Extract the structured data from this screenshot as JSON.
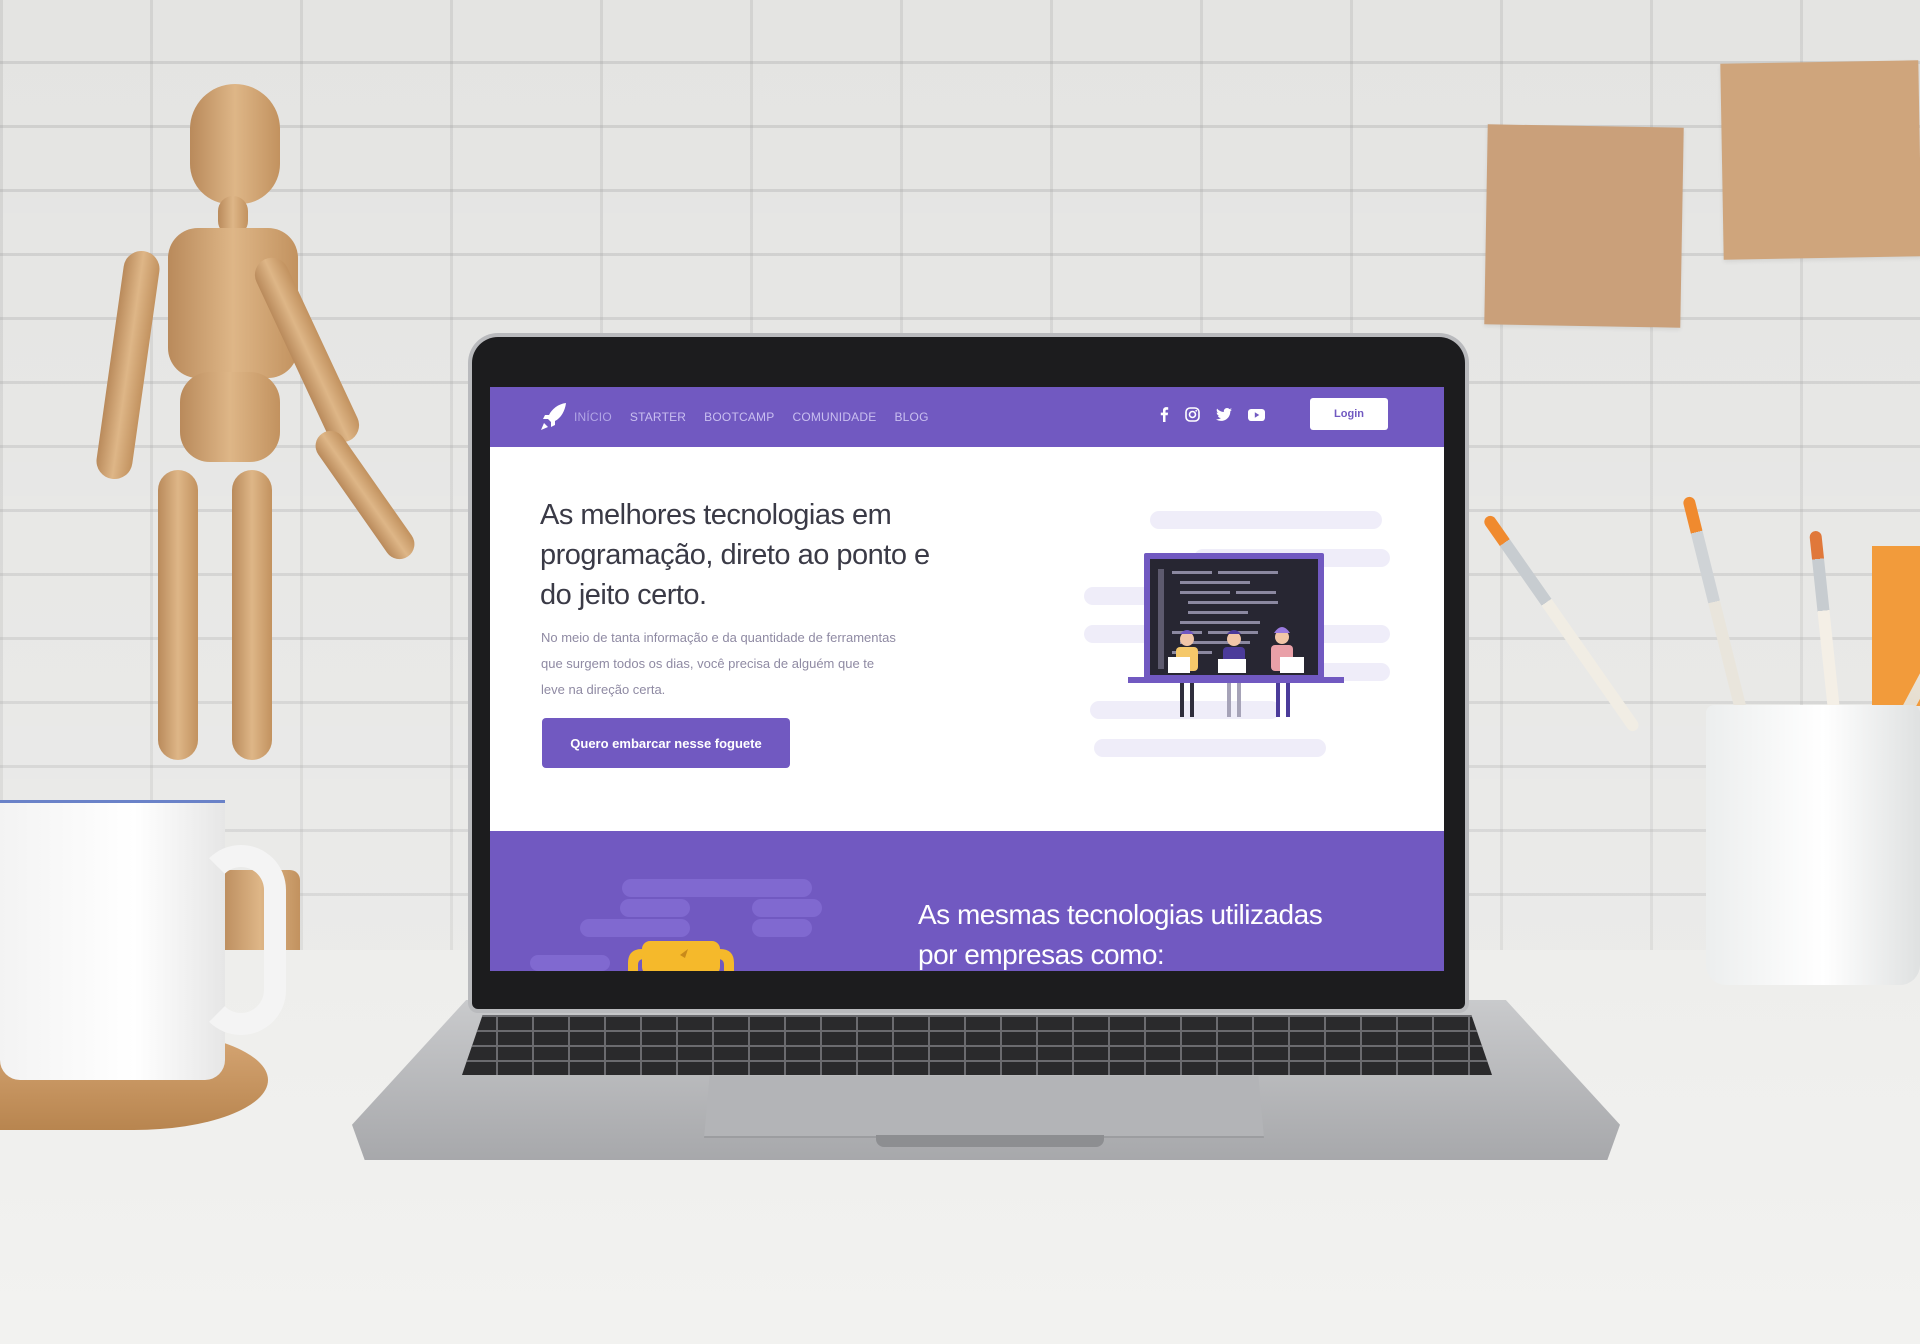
{
  "nav": {
    "links": [
      "INÍCIO",
      "STARTER",
      "BOOTCAMP",
      "COMUNIDADE",
      "BLOG"
    ],
    "social_icons": [
      "facebook-icon",
      "instagram-icon",
      "twitter-icon",
      "youtube-icon"
    ],
    "login_label": "Login"
  },
  "hero": {
    "title": "As melhores tecnologias em programação, direto ao ponto e do jeito certo.",
    "text": "No meio de tanta informação e da quantidade de ferramentas que surgem todos os dias, você precisa de alguém que te leve na direção certa.",
    "cta_label": "Quero embarcar nesse foguete"
  },
  "companies": {
    "title": "As mesmas tecnologias utilizadas por empresas como:"
  },
  "colors": {
    "brand": "#7159c1",
    "nav_text": "#c9bff0",
    "title_text": "#3a3a46",
    "body_text": "#8f8aa3",
    "trophy": "#f5b92b"
  },
  "icons": [
    "rocket-logo-icon",
    "trophy-icon"
  ]
}
